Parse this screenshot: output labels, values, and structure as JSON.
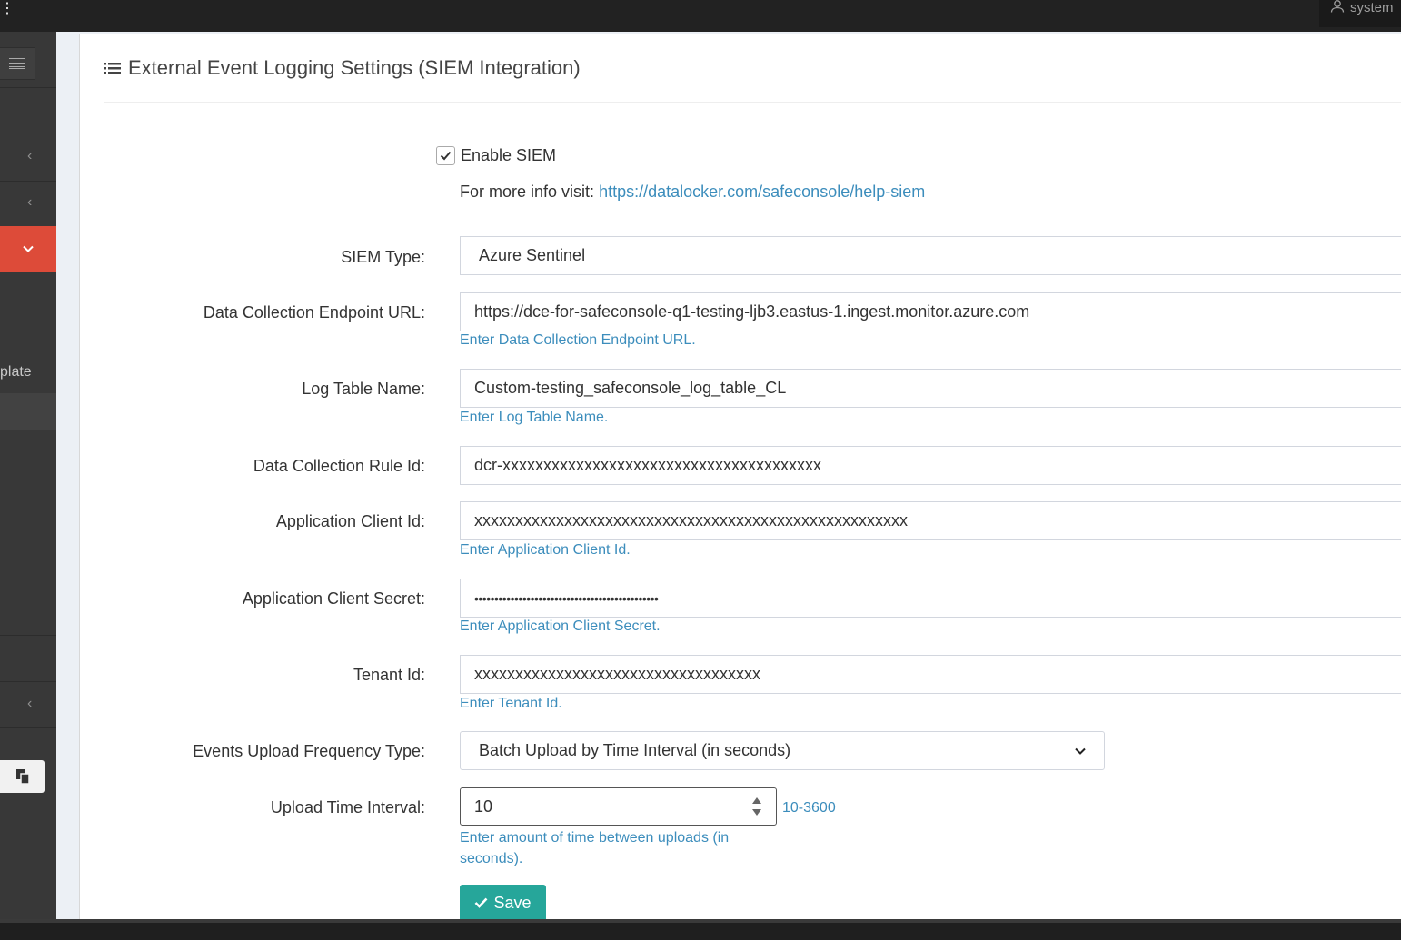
{
  "topbar": {
    "user_label": "system"
  },
  "sidebar": {
    "partial_label": "plate"
  },
  "page": {
    "title": "External Event Logging Settings (SIEM Integration)"
  },
  "siem": {
    "enable_label": "Enable SIEM",
    "enabled": true,
    "info_prefix": "For more info visit:",
    "info_link": "https://datalocker.com/safeconsole/help-siem"
  },
  "fields": {
    "siem_type": {
      "label": "SIEM Type:",
      "value": "Azure Sentinel"
    },
    "endpoint_url": {
      "label": "Data Collection Endpoint URL:",
      "value": "https://dce-for-safeconsole-q1-testing-ljb3.eastus-1.ingest.monitor.azure.com",
      "help": "Enter Data Collection Endpoint URL."
    },
    "log_table": {
      "label": "Log Table Name:",
      "value": "Custom-testing_safeconsole_log_table_CL",
      "help": "Enter Log Table Name."
    },
    "rule_id": {
      "label": "Data Collection Rule Id:",
      "value": "dcr-xxxxxxxxxxxxxxxxxxxxxxxxxxxxxxxxxxxxxxx"
    },
    "client_id": {
      "label": "Application Client Id:",
      "value": "xxxxxxxxxxxxxxxxxxxxxxxxxxxxxxxxxxxxxxxxxxxxxxxxxxxxx",
      "help": "Enter Application Client Id."
    },
    "client_secret": {
      "label": "Application Client Secret:",
      "value": "••••••••••••••••••••••••••••••••••••••••••••••",
      "help": "Enter Application Client Secret."
    },
    "tenant_id": {
      "label": "Tenant Id:",
      "value": "xxxxxxxxxxxxxxxxxxxxxxxxxxxxxxxxxxx",
      "help": "Enter Tenant Id."
    },
    "frequency_type": {
      "label": "Events Upload Frequency Type:",
      "value": "Batch Upload by Time Interval (in seconds)"
    },
    "time_interval": {
      "label": "Upload Time Interval:",
      "value": "10",
      "range": "10-3600",
      "help": "Enter amount of time between uploads (in seconds)."
    }
  },
  "actions": {
    "save_label": "Save"
  },
  "colors": {
    "accent": "#3c8dbc",
    "active_nav": "#dd4b39",
    "save": "#26a69a"
  }
}
